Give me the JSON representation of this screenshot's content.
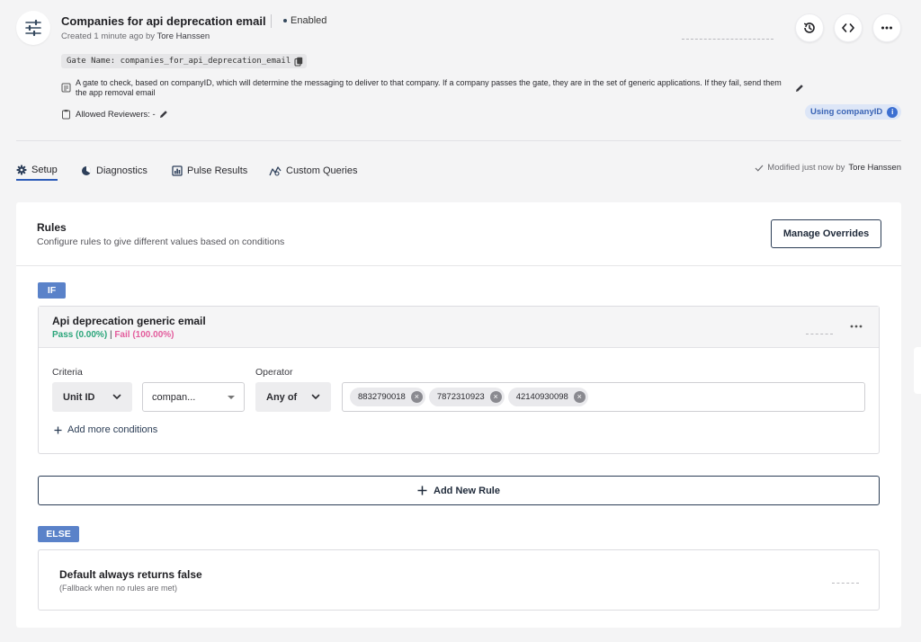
{
  "header": {
    "title": "Companies for api deprecation email",
    "status": "Enabled",
    "created_prefix": "Created 1 minute ago by ",
    "created_by": "Tore Hanssen",
    "gate_name": "Gate Name: companies_for_api_deprecation_email",
    "description": "A gate to check, based on companyID, which will determine the messaging to deliver to that company. If a company passes the gate, they are in the set of generic applications. If they fail, send them the app removal email",
    "reviewers_label": "Allowed Reviewers: -",
    "id_type_badge": "Using companyID",
    "info_glyph": "i",
    "actions": [
      "history-icon",
      "code-icon",
      "more-icon"
    ]
  },
  "tabs": [
    {
      "label": "Setup",
      "icon": "gear-icon",
      "active": true
    },
    {
      "label": "Diagnostics",
      "icon": "diagnostics-icon",
      "active": false
    },
    {
      "label": "Pulse Results",
      "icon": "bar-chart-icon",
      "active": false
    },
    {
      "label": "Custom Queries",
      "icon": "query-icon",
      "active": false
    }
  ],
  "modified": {
    "prefix": "Modified just now by ",
    "by": "Tore Hanssen"
  },
  "rules": {
    "title": "Rules",
    "subtitle": "Configure rules to give different values based on conditions",
    "manage_overrides": "Manage Overrides",
    "if_label": "IF",
    "rule": {
      "name": "Api deprecation generic email",
      "pass": "Pass (0.00%)",
      "separator": "|",
      "fail": "Fail (100.00%)",
      "criteria_label": "Criteria",
      "criteria_value": "Unit ID",
      "unit_value": "compan...",
      "operator_label": "Operator",
      "operator_value": "Any of",
      "values": [
        "8832790018",
        "7872310923",
        "42140930098"
      ],
      "add_conditions": "Add more conditions"
    },
    "add_new_rule": "Add New Rule",
    "else_label": "ELSE",
    "default_title": "Default always returns false",
    "default_sub": "(Fallback when no rules are met)"
  },
  "colors": {
    "accent": "#2d5cb8",
    "badge": "#5a82c9",
    "pass": "#2aa57a",
    "fail": "#e35d9d"
  }
}
